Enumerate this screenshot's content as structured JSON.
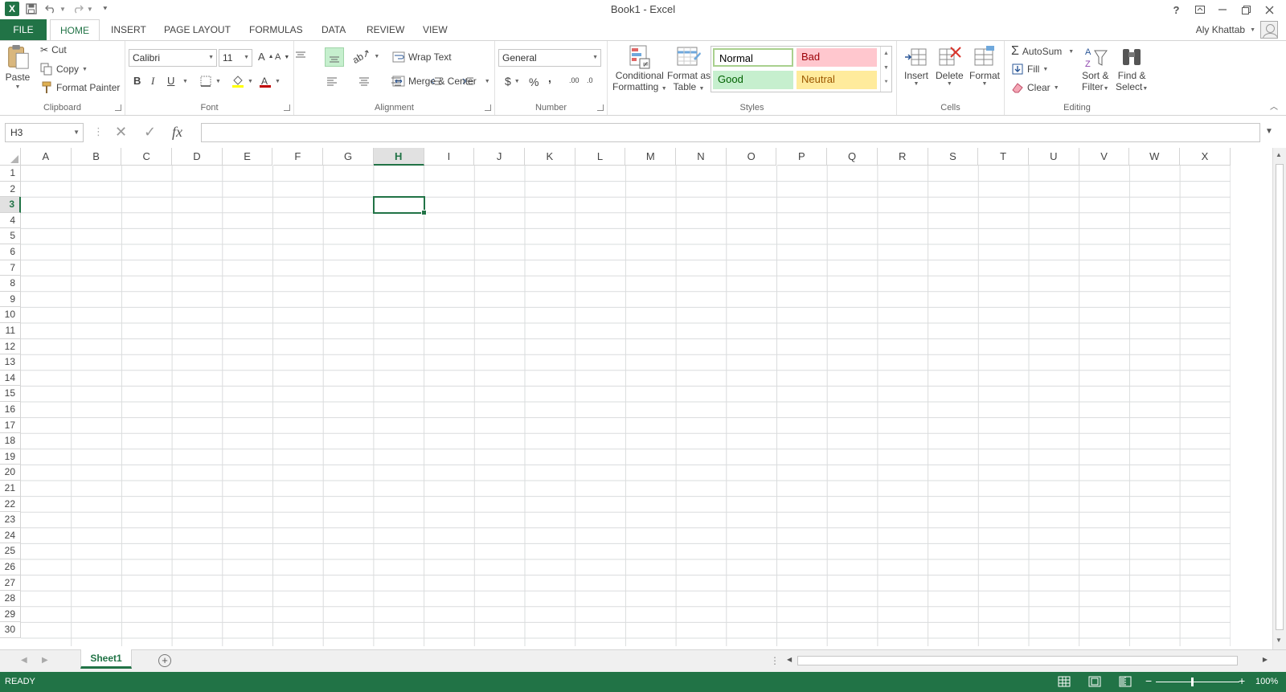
{
  "window": {
    "title": "Book1 - Excel"
  },
  "user": {
    "name": "Aly Khattab"
  },
  "tabs": [
    "FILE",
    "HOME",
    "INSERT",
    "PAGE LAYOUT",
    "FORMULAS",
    "DATA",
    "REVIEW",
    "VIEW"
  ],
  "active_tab": "HOME",
  "clipboard": {
    "paste": "Paste",
    "cut": "Cut",
    "copy": "Copy",
    "format_painter": "Format Painter",
    "label": "Clipboard"
  },
  "font": {
    "name": "Calibri",
    "size": "11",
    "label": "Font",
    "bold": "B",
    "italic": "I",
    "underline": "U"
  },
  "alignment": {
    "wrap_text": "Wrap Text",
    "merge_center": "Merge & Center",
    "label": "Alignment"
  },
  "number": {
    "format": "General",
    "label": "Number",
    "currency": "$",
    "percent": "%",
    "comma": ",",
    "inc_decimal": ".00",
    "dec_decimal": ".0"
  },
  "styles": {
    "conditional_formatting_1": "Conditional",
    "conditional_formatting_2": "Formatting",
    "format_as_table_1": "Format as",
    "format_as_table_2": "Table",
    "normal": "Normal",
    "bad": "Bad",
    "good": "Good",
    "neutral": "Neutral",
    "label": "Styles",
    "colors": {
      "normal_bg": "#ffffff",
      "bad_bg": "#ffc7ce",
      "bad_fg": "#9c0006",
      "good_bg": "#c6efce",
      "good_fg": "#006100",
      "neutral_bg": "#ffeb9c",
      "neutral_fg": "#9c5700"
    }
  },
  "cells_group": {
    "insert": "Insert",
    "delete": "Delete",
    "format": "Format",
    "label": "Cells"
  },
  "editing": {
    "autosum": "AutoSum",
    "fill": "Fill",
    "clear": "Clear",
    "sort_filter_1": "Sort &",
    "sort_filter_2": "Filter",
    "find_select_1": "Find &",
    "find_select_2": "Select",
    "label": "Editing"
  },
  "formula_bar": {
    "name_box": "H3",
    "formula": "",
    "fx": "fx"
  },
  "columns": [
    "A",
    "B",
    "C",
    "D",
    "E",
    "F",
    "G",
    "H",
    "I",
    "J",
    "K",
    "L",
    "M",
    "N",
    "O",
    "P",
    "Q",
    "R",
    "S",
    "T",
    "U",
    "V",
    "W",
    "X"
  ],
  "rows": [
    "1",
    "2",
    "3",
    "4",
    "5",
    "6",
    "7",
    "8",
    "9",
    "10",
    "11",
    "12",
    "13",
    "14",
    "15",
    "16",
    "17",
    "18",
    "19",
    "20",
    "21",
    "22",
    "23",
    "24",
    "25",
    "26",
    "27",
    "28",
    "29",
    "30"
  ],
  "selected_cell": {
    "column": "H",
    "row": "3"
  },
  "sheets": [
    "Sheet1"
  ],
  "active_sheet": "Sheet1",
  "status": {
    "mode": "READY",
    "zoom": "100%",
    "zoom_fraction": 0.42
  },
  "accent_color": "#217346"
}
